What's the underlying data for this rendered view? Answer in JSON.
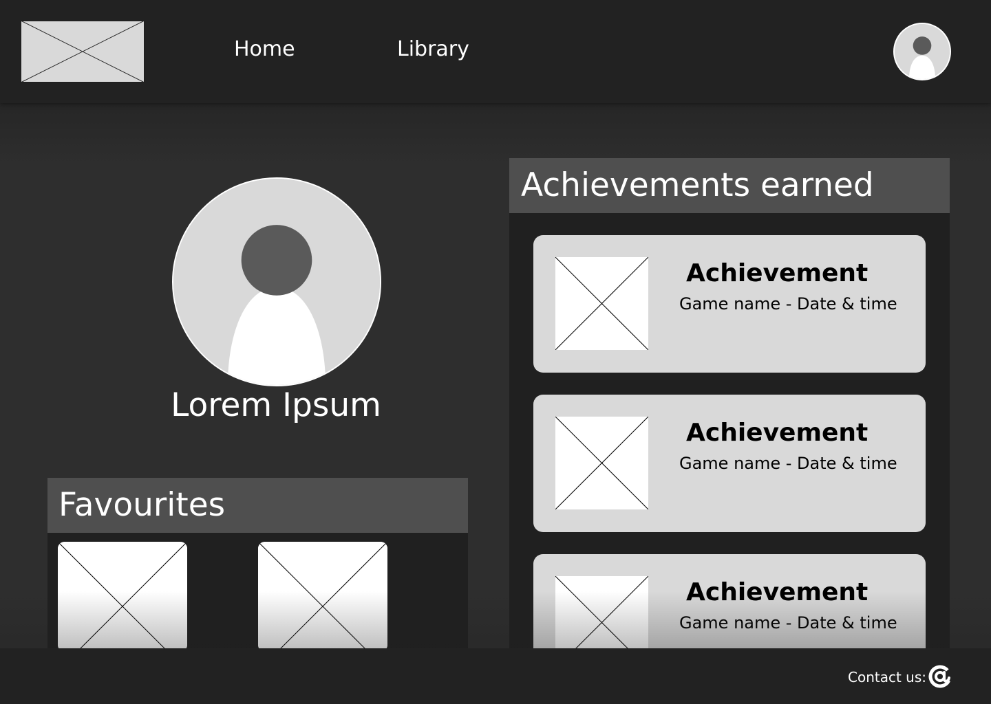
{
  "header": {
    "logo_icon": "logo-placeholder-icon",
    "nav": [
      {
        "label": "Home"
      },
      {
        "label": "Library"
      }
    ],
    "avatar_icon": "user-avatar-icon"
  },
  "profile": {
    "avatar_icon": "user-avatar-icon",
    "name": "Lorem Ipsum"
  },
  "favourites": {
    "title": "Favourites",
    "items": [
      {
        "icon": "image-placeholder-icon"
      },
      {
        "icon": "image-placeholder-icon"
      }
    ]
  },
  "achievements": {
    "title": "Achievements earned",
    "items": [
      {
        "name": "Achievement",
        "meta": "Game name - Date & time",
        "icon": "image-placeholder-icon"
      },
      {
        "name": "Achievement",
        "meta": "Game name - Date & time",
        "icon": "image-placeholder-icon"
      },
      {
        "name": "Achievement",
        "meta": "Game name - Date & time",
        "icon": "image-placeholder-icon"
      }
    ]
  },
  "footer": {
    "contact_label": "Contact us:",
    "contact_icon": "at-sign-icon"
  },
  "colors": {
    "background": "#2e2e2e",
    "header": "#222222",
    "panel": "#202020",
    "panel_title_bar": "#4f4f4f",
    "card": "#d9d9d9",
    "avatar_head": "#5a5a5a"
  }
}
